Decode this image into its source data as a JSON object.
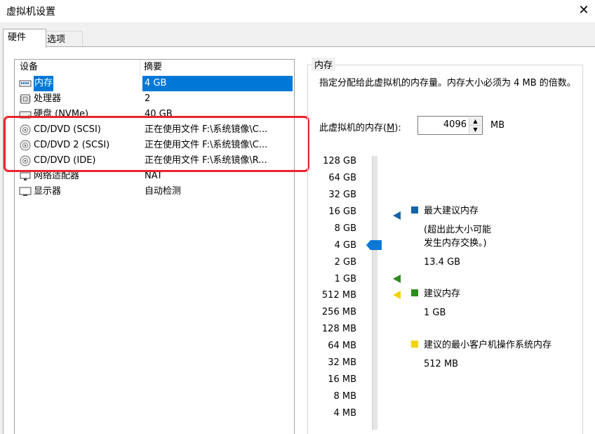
{
  "window": {
    "title": "虚拟机设置"
  },
  "tabs": {
    "hardware": "硬件",
    "options": "选项"
  },
  "device_list": {
    "col_device": "设备",
    "col_summary": "摘要",
    "rows": [
      {
        "name": "内存",
        "summary": "4 GB",
        "icon": "memory-icon"
      },
      {
        "name": "处理器",
        "summary": "2",
        "icon": "cpu-icon"
      },
      {
        "name": "硬盘 (NVMe)",
        "summary": "40 GB",
        "icon": "harddisk-icon"
      },
      {
        "name": "CD/DVD (SCSI)",
        "summary": "正在使用文件 F:\\系统镜像\\C...",
        "icon": "cd-icon"
      },
      {
        "name": "CD/DVD 2 (SCSI)",
        "summary": "正在使用文件 F:\\系统镜像\\C...",
        "icon": "cd-icon"
      },
      {
        "name": "CD/DVD (IDE)",
        "summary": "正在使用文件 F:\\系统镜像\\R...",
        "icon": "cd-icon"
      },
      {
        "name": "网络适配器",
        "summary": "NAT",
        "icon": "network-icon"
      },
      {
        "name": "显示器",
        "summary": "自动检测",
        "icon": "monitor-icon"
      }
    ]
  },
  "memory": {
    "group_title": "内存",
    "description": "指定分配给此虚拟机的内存量。内存大小必须为 4 MB 的倍数。",
    "label": "此虚拟机的内存(M):",
    "label_pre": "此虚拟机的内存(",
    "label_key": "M",
    "label_post": "):",
    "value": "4096",
    "unit": "MB",
    "scale": [
      "128 GB",
      "64 GB",
      "32 GB",
      "16 GB",
      "8 GB",
      "4 GB",
      "2 GB",
      "1 GB",
      "512 MB",
      "256 MB",
      "128 MB",
      "64 MB",
      "32 MB",
      "16 MB",
      "8 MB",
      "4 MB"
    ],
    "slider_value": "4 GB",
    "legend": {
      "max_title": "最大建议内存",
      "max_note_1": "(超出此大小可能",
      "max_note_2": "发生内存交换。)",
      "max_value": "13.4 GB",
      "rec_title": "建议内存",
      "rec_value": "1 GB",
      "min_title": "建议的最小客户机操作系统内存",
      "min_value": "512 MB"
    },
    "colors": {
      "max": "#1565a8",
      "rec": "#2e8b1e",
      "min": "#f2d400",
      "thumb": "#0a78d7"
    }
  }
}
